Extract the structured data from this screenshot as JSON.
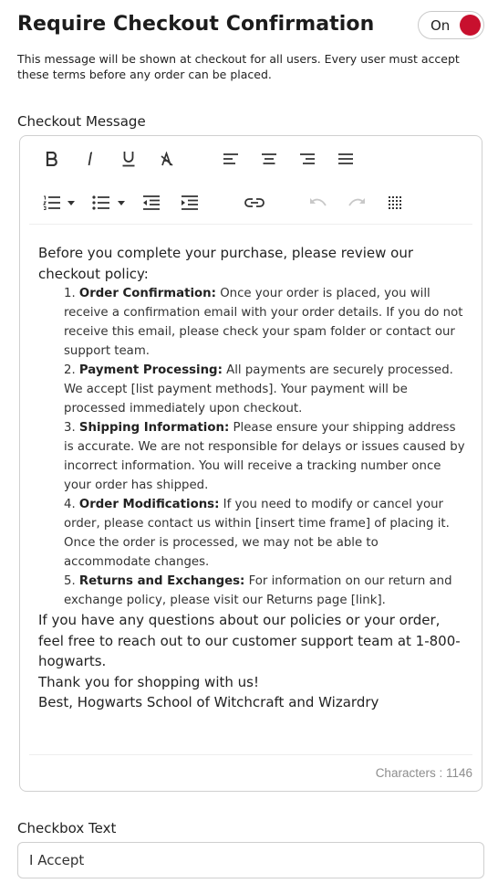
{
  "header": {
    "title": "Require Checkout Confirmation",
    "toggle_label": "On"
  },
  "description": "This message will be shown at checkout for all users. Every user must accept these terms before any order can be placed.",
  "checkout_message": {
    "label": "Checkout Message",
    "toolbar": [
      "bold-icon",
      "italic-icon",
      "underline-icon",
      "clear-format-icon",
      "align-left-icon",
      "align-center-icon",
      "align-right-icon",
      "align-justify-icon",
      "ordered-list-icon",
      "chevron-down-icon",
      "unordered-list-icon",
      "chevron-down-icon",
      "outdent-icon",
      "indent-icon",
      "link-icon",
      "undo-icon",
      "redo-icon",
      "table-icon"
    ],
    "intro": "Before you complete your purchase, please review our checkout policy:",
    "items": [
      {
        "number": "1.",
        "heading": "Order Confirmation:",
        "text": "Once your order is placed, you will receive a confirmation email with your order details. If you do not receive this email, please check your spam folder or contact our support team."
      },
      {
        "number": "2.",
        "heading": "Payment Processing:",
        "text": "All payments are securely processed. We accept [list payment methods]. Your payment will be processed immediately upon checkout."
      },
      {
        "number": "3.",
        "heading": "Shipping Information:",
        "text": "Please ensure your shipping address is accurate. We are not responsible for delays or issues caused by incorrect information. You will receive a tracking number once your order has shipped."
      },
      {
        "number": "4.",
        "heading": "Order Modifications:",
        "text": "If you need to modify or cancel your order, please contact us within [insert time frame] of placing it. Once the order is processed, we may not be able to accommodate changes."
      },
      {
        "number": "5.",
        "heading": "Returns and Exchanges:",
        "text": "For information on our return and exchange policy, please visit our Returns page [link]."
      }
    ],
    "outro_1": "If you have any questions about our policies or your order, feel free to reach out to our customer support team at 1-800-hogwarts.",
    "outro_2": "Thank you for shopping with us!",
    "outro_3": "Best, Hogwarts School of Witchcraft and Wizardry",
    "char_count": "Characters : 1146"
  },
  "checkbox_text": {
    "label": "Checkbox Text",
    "value": "I Accept"
  },
  "colors": {
    "toggle_on": "#c8102e"
  }
}
